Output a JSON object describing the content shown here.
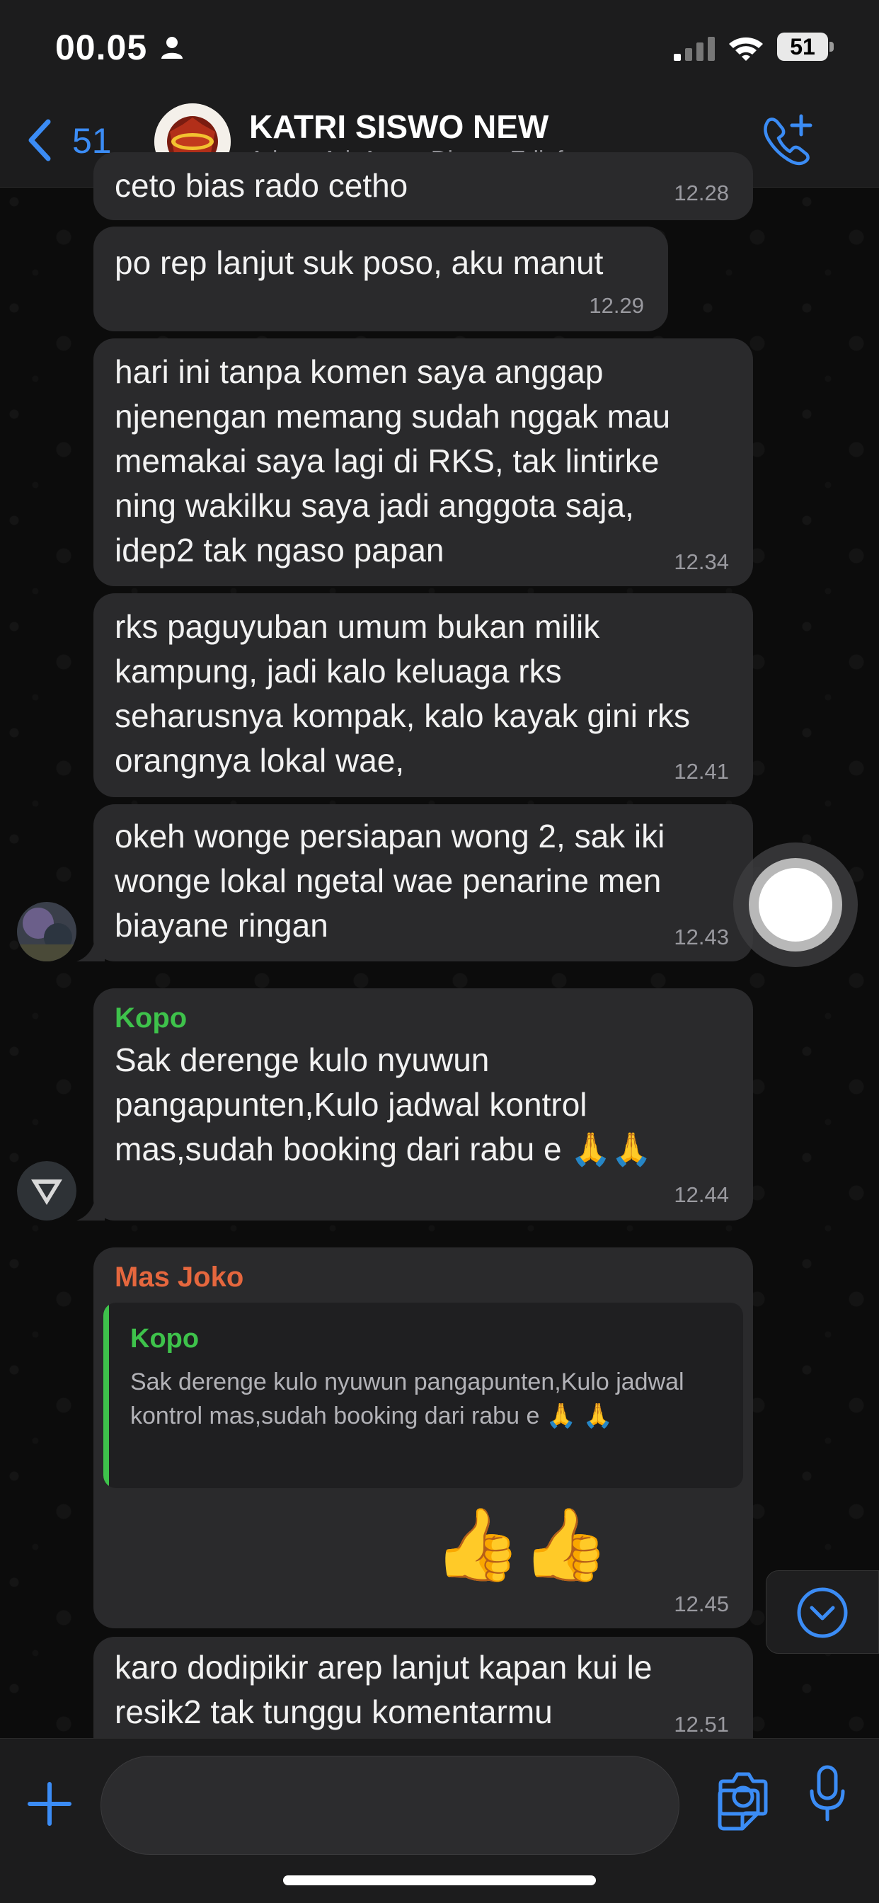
{
  "status_bar": {
    "time": "00.05",
    "battery": "51"
  },
  "header": {
    "back_count": "51",
    "title": "KATRI SISWO NEW",
    "subtitle": "Adam, Ari, Arum, Dimas, Edi, farrynur,..."
  },
  "messages": [
    {
      "text": "ceto bias rado cetho",
      "time": "12.28"
    },
    {
      "text": "po rep lanjut suk poso, aku manut",
      "time": "12.29"
    },
    {
      "lines": [
        "hari ini tanpa komen saya anggap",
        "njenengan memang sudah nggak mau",
        "memakai saya lagi di RKS, tak lintirke",
        "ning wakilku saya jadi anggota saja,",
        "idep2 tak ngaso papan"
      ],
      "time": "12.34"
    },
    {
      "lines": [
        "rks paguyuban umum bukan milik",
        "kampung, jadi kalo keluaga rks",
        "seharusnya kompak, kalo kayak gini rks",
        "orangnya lokal wae,"
      ],
      "time": "12.41"
    },
    {
      "lines": [
        "okeh wonge persiapan wong 2, sak iki",
        "wonge lokal ngetal wae penarine men",
        "biayane ringan"
      ],
      "time": "12.43"
    },
    {
      "sender": "Kopo",
      "lines": [
        "Sak derenge kulo nyuwun",
        "pangapunten,Kulo jadwal kontrol",
        "mas,sudah booking dari rabu e 🙏🙏"
      ],
      "time": "12.44"
    },
    {
      "sender": "Mas Joko",
      "quote_sender": "Kopo",
      "quote_text": "Sak derenge kulo nyuwun pangapunten,Kulo jadwal kontrol mas,sudah booking dari rabu e 🙏 🙏",
      "text": "👍👍",
      "time": "12.45"
    },
    {
      "lines": [
        "karo dodipikir arep lanjut kapan kui le",
        "resik2 tak tunggu komentarmu"
      ],
      "time": "12.51"
    }
  ],
  "colors": {
    "accent": "#3b8cf5",
    "kopo": "#3ec24b",
    "mas_joko": "#e5673e"
  },
  "input": {
    "placeholder": ""
  }
}
